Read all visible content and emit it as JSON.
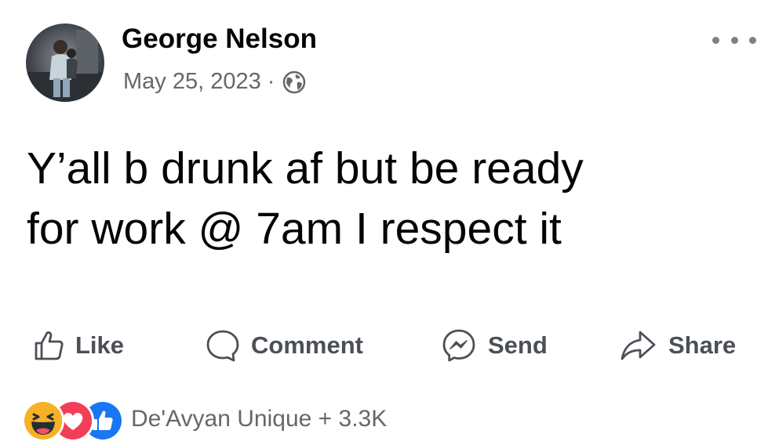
{
  "post": {
    "author": "George Nelson",
    "date": "May 25, 2023",
    "separator": "·",
    "privacy_icon": "globe-icon",
    "text": "Y’all b drunk af but be ready\nfor work @ 7am I respect it"
  },
  "actions": {
    "like_label": "Like",
    "comment_label": "Comment",
    "send_label": "Send",
    "share_label": "Share"
  },
  "reactions": {
    "icons": [
      "haha-reaction-icon",
      "love-reaction-icon",
      "like-reaction-icon"
    ],
    "summary": "De'Avyan Unique + 3.3K"
  },
  "colors": {
    "text": "#050505",
    "secondary_text": "#65676b",
    "action_text": "#4b4f56",
    "like_blue": "#1877f2",
    "love_red": "#f33e58",
    "haha_yellow": "#f7b125"
  }
}
